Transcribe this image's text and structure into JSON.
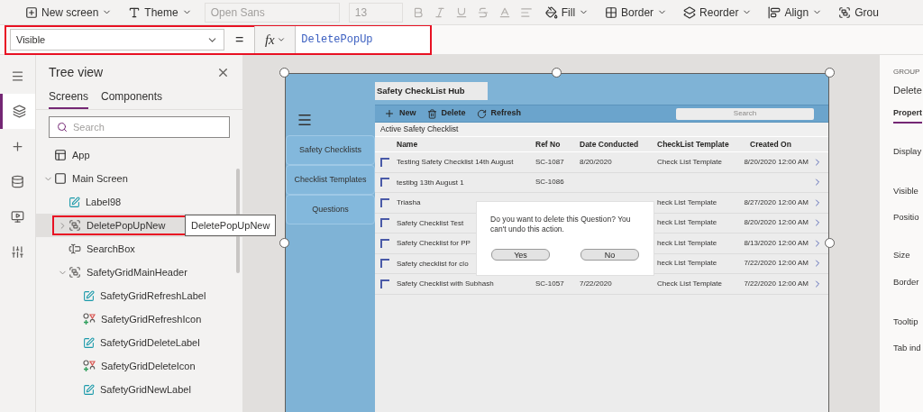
{
  "toolbar": [
    {
      "kind": "menu",
      "label": "New screen",
      "chevron": true
    },
    {
      "kind": "menu",
      "label": "Theme",
      "chevron": true
    },
    {
      "kind": "select",
      "label": "Open Sans",
      "disabled": true
    },
    {
      "kind": "select",
      "label": "13",
      "disabled": true
    },
    {
      "kind": "tool",
      "disabled": true
    },
    {
      "kind": "tool",
      "disabled": true
    },
    {
      "kind": "tool",
      "disabled": true
    },
    {
      "kind": "tool",
      "disabled": true
    },
    {
      "kind": "tool",
      "disabled": true
    },
    {
      "kind": "tool",
      "disabled": true
    },
    {
      "kind": "menu",
      "label": "Fill",
      "chevron": true
    },
    {
      "kind": "menu",
      "label": "Border",
      "chevron": true
    },
    {
      "kind": "menu",
      "label": "Reorder",
      "chevron": true
    },
    {
      "kind": "menu",
      "label": "Align",
      "chevron": true
    },
    {
      "kind": "menu",
      "label": "Grou",
      "chevron": false
    }
  ],
  "formula_bar": {
    "marked": true,
    "property": "Visible",
    "operator": "=",
    "fx": "fx",
    "formula": "DeletePopUp"
  },
  "rail": [
    {
      "selected": false
    },
    {
      "selected": true
    },
    {
      "selected": false
    },
    {
      "selected": false
    },
    {
      "selected": false
    },
    {
      "selected": false
    }
  ],
  "tree_view": {
    "title": "Tree view",
    "tabs": [
      {
        "label": "Screens",
        "selected": true
      },
      {
        "label": "Components",
        "selected": false
      }
    ],
    "search": {
      "placeholder": "Search"
    },
    "items": [
      {
        "kind": "app",
        "label": "App",
        "selected": false
      },
      {
        "kind": "screen",
        "label": "Main Screen",
        "expanded": true,
        "selected": false,
        "children": [
          {
            "kind": "label",
            "label": "Label98",
            "selected": false
          },
          {
            "kind": "group",
            "label": "DeletePopUpNew",
            "expanded": false,
            "selected": true,
            "marked": true,
            "has_children": true
          },
          {
            "kind": "input",
            "label": "SearchBox",
            "selected": false
          },
          {
            "kind": "group",
            "label": "SafetyGridMainHeader",
            "expanded": true,
            "selected": false,
            "children": [
              {
                "kind": "label",
                "label": "SafetyGridRefreshLabel",
                "selected": false
              },
              {
                "kind": "icon",
                "label": "SafetyGridRefreshIcon",
                "selected": false
              },
              {
                "kind": "label",
                "label": "SafetyGridDeleteLabel",
                "selected": false
              },
              {
                "kind": "icon",
                "label": "SafetyGridDeleteIcon",
                "selected": false
              },
              {
                "kind": "label",
                "label": "SafetyGridNewLabel",
                "selected": false
              }
            ]
          }
        ]
      }
    ],
    "tooltip": "DeletePopUpNew"
  },
  "app_screen": {
    "title": "Safety CheckList Hub",
    "nav": [
      "Safety Checklists",
      "Checklist Templates",
      "Questions"
    ],
    "actions": [
      {
        "kind": "new",
        "label": "New"
      },
      {
        "kind": "delete",
        "label": "Delete"
      },
      {
        "kind": "refresh",
        "label": "Refresh"
      }
    ],
    "search": {
      "placeholder": "Search"
    },
    "section_title": "Active Safety Checklist",
    "columns": [
      "Name",
      "Ref No",
      "Date Conducted",
      "CheckList Template",
      "Created On"
    ],
    "rows": [
      {
        "checked": false,
        "name": "Testing Safety Checklist 14th August",
        "ref_no": "SC-1087",
        "date_conducted": "8/20/2020",
        "template": "Check List Template",
        "created_on": "8/20/2020 12:00 AM"
      },
      {
        "checked": false,
        "name": "testibg 13th August 1",
        "ref_no": "SC-1086"
      },
      {
        "checked": false,
        "name": "Triasha",
        "template": "heck List Template",
        "created_on": "8/27/2020 12:00 AM"
      },
      {
        "checked": false,
        "name": "Safety Checklist Test",
        "template": "heck List Template",
        "created_on": "8/20/2020 12:00 AM"
      },
      {
        "checked": false,
        "name": "Safety Checklist for PP",
        "template": "heck List Template",
        "created_on": "8/13/2020 12:00 AM"
      },
      {
        "checked": false,
        "name": "Safety checklist for clo",
        "template": "heck List Template",
        "created_on": "7/22/2020 12:00 AM"
      },
      {
        "checked": false,
        "name": "Safety Checklist with Subhash",
        "ref_no": "SC-1057",
        "date_conducted": "7/22/2020",
        "template": "Check List Template",
        "created_on": "7/22/2020 12:00 AM"
      }
    ],
    "dialog": {
      "message": "Do you want to delete this Question? You can't undo this action.",
      "buttons": [
        "Yes",
        "No"
      ]
    }
  },
  "properties_panel": {
    "type_label": "GROUP",
    "name": "Delete",
    "tabs": [
      {
        "label": "Propert",
        "selected": true
      }
    ],
    "properties": [
      "Display",
      "Visible",
      "Positio",
      "Size",
      "Border",
      "Tooltip",
      "Tab ind"
    ]
  }
}
